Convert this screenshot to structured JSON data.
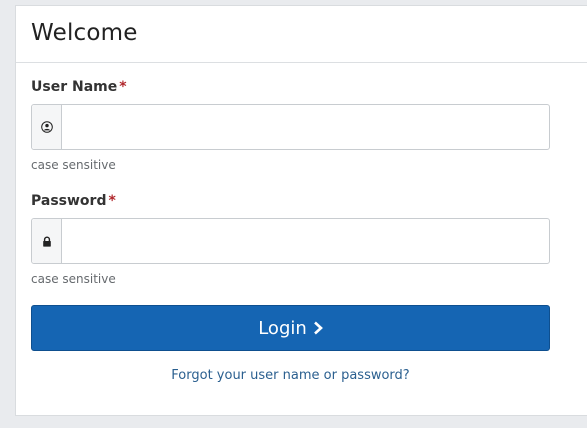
{
  "panel": {
    "title": "Welcome"
  },
  "username": {
    "label": "User Name",
    "required_mark": "*",
    "value": "",
    "placeholder": "",
    "icon": "user-icon",
    "hint": "case sensitive"
  },
  "password": {
    "label": "Password",
    "required_mark": "*",
    "value": "",
    "placeholder": "",
    "icon": "lock-icon",
    "hint": "case sensitive"
  },
  "login_button": {
    "label": "Login",
    "icon": "chevron-right-icon"
  },
  "forgot_link": {
    "label": "Forgot your user name or password?"
  },
  "colors": {
    "primary": "#1565b3",
    "required": "#b0262b",
    "link": "#2a5f8f"
  }
}
